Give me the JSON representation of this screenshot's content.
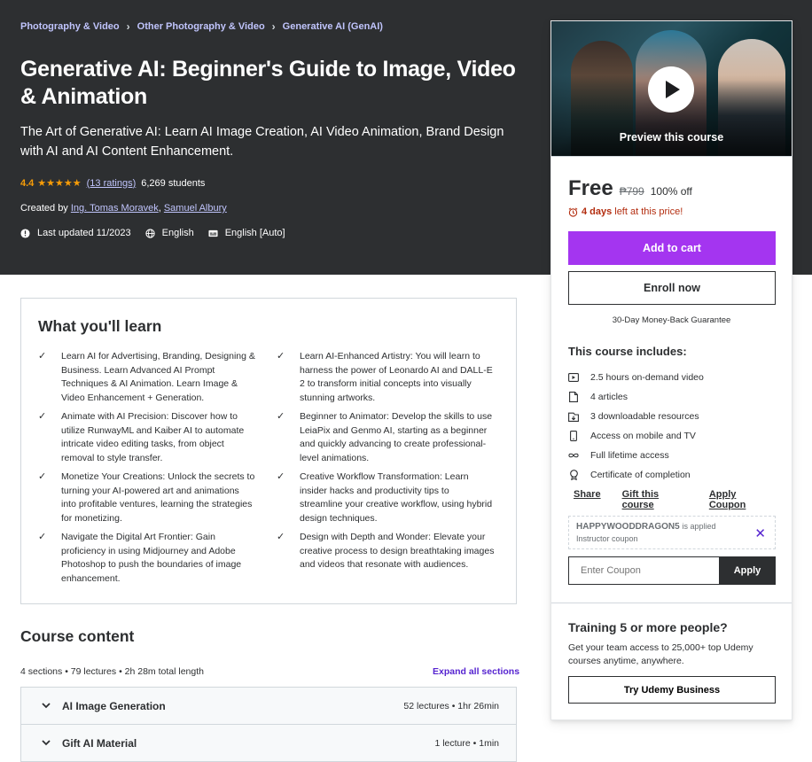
{
  "breadcrumb": [
    "Photography & Video",
    "Other Photography & Video",
    "Generative AI (GenAI)"
  ],
  "course": {
    "title": "Generative AI: Beginner's Guide to Image, Video & Animation",
    "subtitle": "The Art of Generative AI: Learn AI Image Creation, AI Video Animation, Brand Design with AI and AI Content Enhancement.",
    "rating": "4.4",
    "stars": "★★★★★",
    "ratings_count": "(13 ratings)",
    "students": "6,269 students",
    "created_by_label": "Created by",
    "instructors": [
      "Ing. Tomas Moravek",
      "Samuel Albury"
    ],
    "last_updated": "Last updated 11/2023",
    "language": "English",
    "captions": "English [Auto]"
  },
  "sidebar": {
    "preview_label": "Preview this course",
    "price": "Free",
    "original_price": "₱799",
    "discount": "100% off",
    "countdown_bold": "4 days",
    "countdown_rest": "left at this price!",
    "add_to_cart": "Add to cart",
    "enroll_now": "Enroll now",
    "guarantee": "30-Day Money-Back Guarantee",
    "includes_title": "This course includes:",
    "includes": [
      {
        "icon": "video-icon",
        "text": "2.5 hours on-demand video"
      },
      {
        "icon": "article-icon",
        "text": "4 articles"
      },
      {
        "icon": "download-icon",
        "text": "3 downloadable resources"
      },
      {
        "icon": "mobile-icon",
        "text": "Access on mobile and TV"
      },
      {
        "icon": "infinity-icon",
        "text": "Full lifetime access"
      },
      {
        "icon": "certificate-icon",
        "text": "Certificate of completion"
      }
    ],
    "links": [
      "Share",
      "Gift this course",
      "Apply Coupon"
    ],
    "coupon_code": "HAPPYWOODDRAGON5",
    "coupon_applied": "is applied",
    "coupon_sub": "Instructor coupon",
    "coupon_placeholder": "Enter Coupon",
    "coupon_apply": "Apply",
    "biz_title": "Training 5 or more people?",
    "biz_text": "Get your team access to 25,000+ top Udemy courses anytime, anywhere.",
    "biz_button": "Try Udemy Business"
  },
  "learn": {
    "title": "What you'll learn",
    "items": [
      "Learn AI for Advertising, Branding, Designing & Business. Learn Advanced AI Prompt Techniques & AI Animation. Learn Image & Video Enhancement + Generation.",
      "Learn AI-Enhanced Artistry: You will learn to harness the power of Leonardo AI and DALL-E 2 to transform initial concepts into visually stunning artworks.",
      "Animate with AI Precision: Discover how to utilize RunwayML and Kaiber AI to automate intricate video editing tasks, from object removal to style transfer.",
      "Beginner to Animator: Develop the skills to use LeiaPix and Genmo AI, starting as a beginner and quickly advancing to create professional-level animations.",
      "Monetize Your Creations: Unlock the secrets to turning your AI-powered art and animations into profitable ventures, learning the strategies for monetizing.",
      "Creative Workflow Transformation: Learn insider hacks and productivity tips to streamline your creative workflow, using hybrid design techniques.",
      "Navigate the Digital Art Frontier: Gain proficiency in using Midjourney and Adobe Photoshop to push the boundaries of image enhancement.",
      "Design with Depth and Wonder: Elevate your creative process to design breathtaking images and videos that resonate with audiences."
    ]
  },
  "content": {
    "title": "Course content",
    "meta": "4 sections • 79 lectures • 2h 28m total length",
    "expand_all": "Expand all sections",
    "sections": [
      {
        "title": "AI Image Generation",
        "meta": "52 lectures • 1hr 26min"
      },
      {
        "title": "Gift AI Material",
        "meta": "1 lecture • 1min"
      }
    ]
  },
  "colors": {
    "hero_bg": "#2d2f31",
    "accent_purple": "#a435f0",
    "link_purple": "#5624d0",
    "star_orange": "#f69c08",
    "alert_red": "#b32d0f"
  }
}
